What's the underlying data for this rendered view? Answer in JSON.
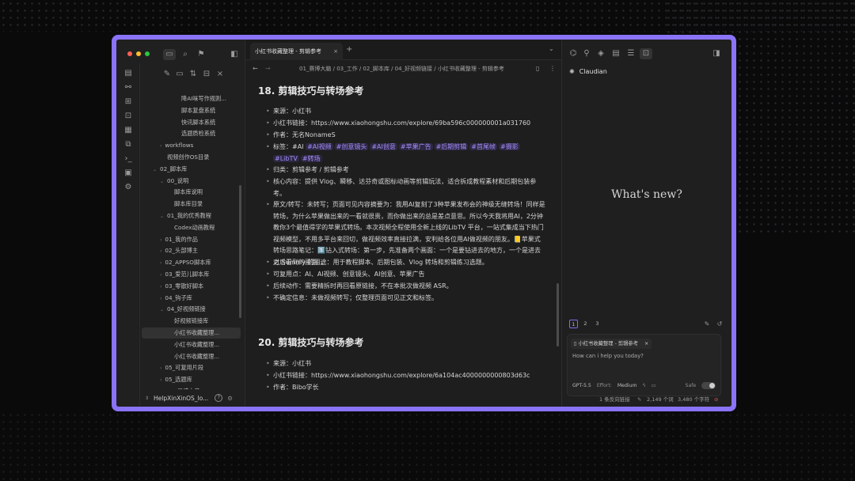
{
  "window": {
    "accent_border": "#8a73f7"
  },
  "sidebar": {
    "tree": [
      {
        "label": "降AI味写作规则...",
        "indent": 3
      },
      {
        "label": "脚本复盘系统",
        "indent": 3
      },
      {
        "label": "快讯脚本系统",
        "indent": 3
      },
      {
        "label": "选题质检系统",
        "indent": 3
      },
      {
        "label": "workflows",
        "indent": 1,
        "caret": "›"
      },
      {
        "label": "视频创作OS目录",
        "indent": 1
      },
      {
        "label": "02_脚本库",
        "indent": 0,
        "caret": "⌄"
      },
      {
        "label": "00_说明",
        "indent": 1,
        "caret": "⌄"
      },
      {
        "label": "脚本库说明",
        "indent": 2
      },
      {
        "label": "脚本库目录",
        "indent": 2
      },
      {
        "label": "01_我的优秀教程",
        "indent": 1,
        "caret": "⌄"
      },
      {
        "label": "Codex动画教程",
        "indent": 2
      },
      {
        "label": "01_我的作品",
        "indent": 1,
        "caret": "›"
      },
      {
        "label": "02_头部博主",
        "indent": 1,
        "caret": "›"
      },
      {
        "label": "02_APPSO脚本库",
        "indent": 1,
        "caret": "›"
      },
      {
        "label": "03_爱范儿脚本库",
        "indent": 1,
        "caret": "›"
      },
      {
        "label": "03_零散好脚本",
        "indent": 1,
        "caret": "›"
      },
      {
        "label": "04_钩子库",
        "indent": 1,
        "caret": "›"
      },
      {
        "label": "04_好视频链接",
        "indent": 1,
        "caret": "⌄"
      },
      {
        "label": "好视频链接库",
        "indent": 2
      },
      {
        "label": "小红书收藏整理...",
        "indent": 2,
        "selected": true
      },
      {
        "label": "小红书收藏整理...",
        "indent": 2
      },
      {
        "label": "小红书收藏整理...",
        "indent": 2
      },
      {
        "label": "05_可复用片段",
        "indent": 1,
        "caret": "›"
      },
      {
        "label": "05_选题库",
        "indent": 1,
        "caret": "›"
      },
      {
        "label": "06_灵感文章",
        "indent": 1,
        "caret": "⌄"
      },
      {
        "label": "灵感文章库",
        "indent": 2
      }
    ],
    "vault_name": "HelpXinXinOS_lo...",
    "vault_help": "?"
  },
  "tab": {
    "title": "小红书收藏整理 - 剪辑参考",
    "close": "×",
    "new": "+"
  },
  "breadcrumb": {
    "path": "01_赛博大脑 / 03_工作 / 02_脚本库 / 04_好视频链接 / 小红书收藏整理 - 剪辑参考",
    "back": "←",
    "forward": "→"
  },
  "note": {
    "section1": {
      "heading": "18. 剪辑技巧与转场参考",
      "source": "来源：小红书",
      "link": "小红书链接：https://www.xiaohongshu.com/explore/69ba596c000000001a031760",
      "author": "作者：无名NonameS",
      "tags_label": "标签：#AI",
      "tags": [
        "#AI视频",
        "#创意镜头",
        "#AI创意",
        "#苹果广告",
        "#后期剪辑",
        "#首尾帧",
        "#摄影",
        "#LibTV",
        "#转场"
      ],
      "category": "归类：剪辑参考 / 剪辑参考",
      "core": "核心内容：提供 Vlog、瞬移、达芬奇或图标动画等剪辑玩法，适合拆成教程素材和后期包装参考。",
      "original": "原文/转写：未转写；页面可见内容摘要为：我用AI复刻了3种苹果发布会的神级无缝转场！同样是转场，为什么苹果做出来的一看就很贵，而你做出来的总是差点意思。所以今天我将用AI，2分钟教你3个最值得学的苹果式转场。本次视频全程使用全新上线的LibTV 平台，一站式集成当下热门视频模型，不用多平台来回切，做视频效率直接拉满，安利给各位用AI做视频的朋友。📒苹果式转场思路笔记：1️⃣钻入式转场：第一步，先准备两个画面：一个是要钻进去的地方，一个是进去之后看到的画面。。",
      "usage": "对 Summy 的用途：用于教程脚本、后期包装、Vlog 转场和剪辑练习选题。",
      "reuse": "可复用点：AI、AI视频、创意镜头、AI创意、苹果广告",
      "followup": "后续动作：需要精拆时再回看原链接，不在本批次做视频 ASR。",
      "uncertain": "不确定信息：未做视频转写；仅整理页面可见正文和标签。"
    },
    "section2": {
      "heading": "20. 剪辑技巧与转场参考",
      "source": "来源：小红书",
      "link": "小红书链接：https://www.xiaohongshu.com/explore/6a104ac4000000000803d63c",
      "author": "作者：Bibo学长"
    }
  },
  "right_panel": {
    "title": "Claudian",
    "whats_new": "What's new?",
    "pages": [
      "1",
      "2",
      "3"
    ],
    "context_chip": "小红书收藏整理 - 剪辑参考",
    "chip_close": "×",
    "placeholder": "How can i help you today?",
    "model": "GPT-5.5",
    "effort_label": "Effort:",
    "effort_value": "Medium",
    "safe_label": "Safe"
  },
  "status_bar": {
    "backlinks": "1 条反向链接",
    "words": "2,149 个词",
    "chars": "3,480 个字符"
  }
}
